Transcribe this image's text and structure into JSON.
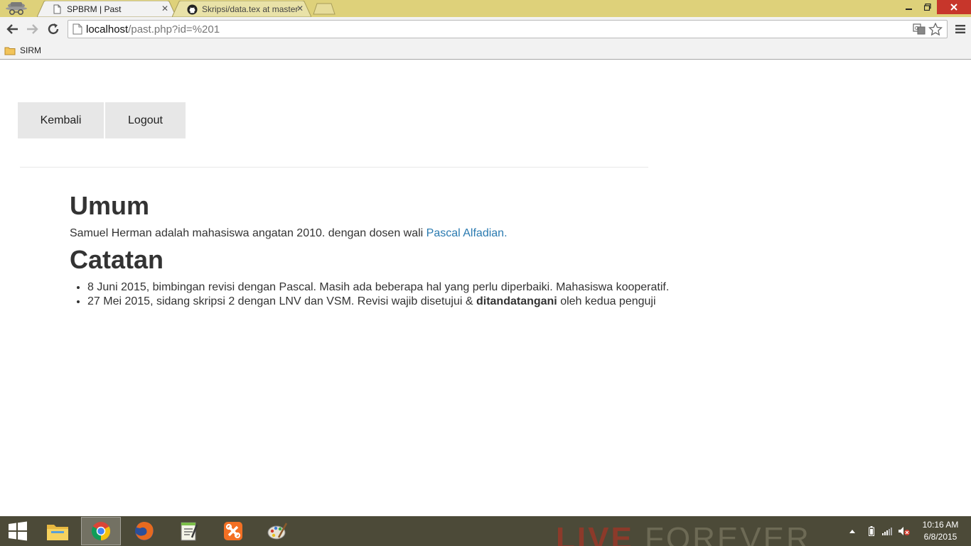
{
  "browser": {
    "tabs": [
      {
        "label": "SPBRM | Past",
        "icon": "page-icon",
        "active": true
      },
      {
        "label": "Skripsi/data.tex at master",
        "icon": "github-icon",
        "active": false
      }
    ],
    "url": {
      "host": "localhost",
      "path": "/past.php?id=%201"
    },
    "bookmarks": [
      {
        "label": "SIRM",
        "icon": "folder-icon"
      }
    ]
  },
  "nav": {
    "back_label": "Kembali",
    "logout_label": "Logout"
  },
  "content": {
    "umum_heading": "Umum",
    "umum_text": "Samuel Herman adalah mahasiswa angatan 2010. dengan dosen wali",
    "dosen_link": "Pascal Alfadian",
    "umum_period": ".",
    "catatan_heading": "Catatan",
    "notes": [
      {
        "text": "8 Juni 2015, bimbingan revisi dengan Pascal. Masih ada beberapa hal yang perlu diperbaiki. Mahasiswa kooperatif."
      },
      {
        "before": "27 Mei 2015, sidang skripsi 2 dengan LNV dan VSM. Revisi wajib disetujui & ",
        "bold": "ditandatangani",
        "after": " oleh kedua penguji"
      }
    ]
  },
  "taskbar": {
    "wallpaper_text": {
      "part1": "LIVE",
      "part2": "FOREVER"
    },
    "apps": [
      "file-explorer-icon",
      "chrome-icon",
      "firefox-icon",
      "notepad-icon",
      "xampp-icon",
      "paint-icon"
    ],
    "clock": {
      "time": "10:16 AM",
      "date": "6/8/2015"
    }
  },
  "colors": {
    "titlebar": "#ded17a",
    "link": "#2a7ab0",
    "taskbar": "#4c4a38",
    "close_button": "#c7362b"
  }
}
